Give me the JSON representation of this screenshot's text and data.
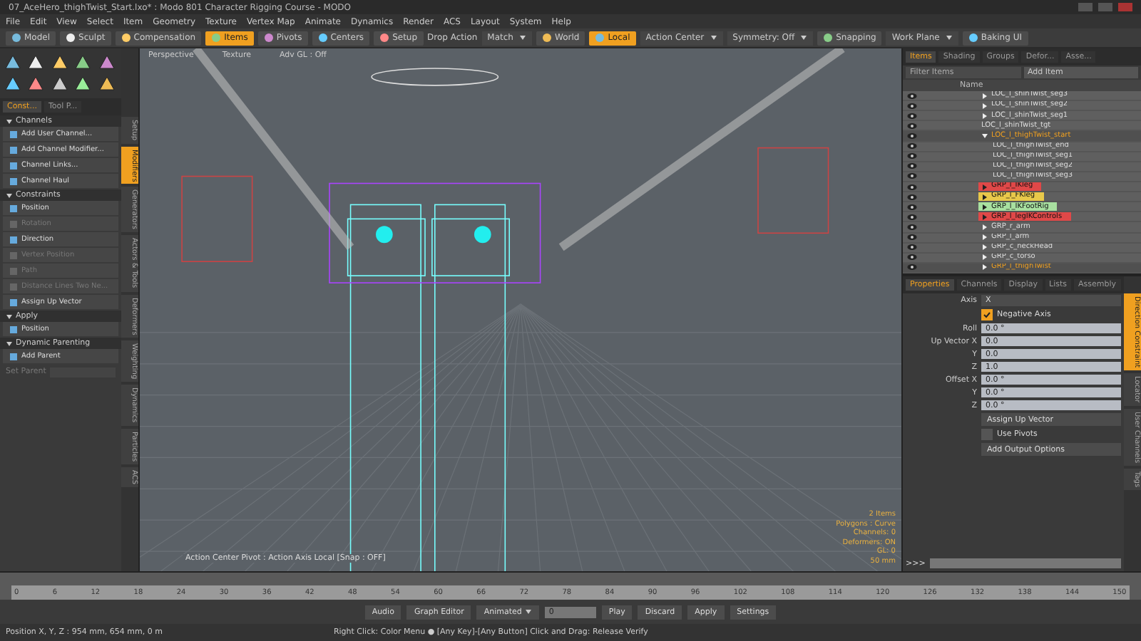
{
  "window": {
    "title": "07_AceHero_thighTwist_Start.lxo* : Modo 801 Character Rigging Course - MODO"
  },
  "menu": [
    "File",
    "Edit",
    "View",
    "Select",
    "Item",
    "Geometry",
    "Texture",
    "Vertex Map",
    "Animate",
    "Dynamics",
    "Render",
    "ACS",
    "Layout",
    "System",
    "Help"
  ],
  "toolbar": [
    {
      "kind": "button",
      "label": "Model",
      "selected": false
    },
    {
      "kind": "button",
      "label": "Sculpt",
      "selected": false
    },
    {
      "kind": "button",
      "label": "Compensation",
      "selected": false
    },
    {
      "kind": "button",
      "label": "Items",
      "selected": true
    },
    {
      "kind": "button",
      "label": "Pivots",
      "selected": false
    },
    {
      "kind": "button",
      "label": "Centers",
      "selected": false
    },
    {
      "kind": "button",
      "label": "Setup",
      "selected": false
    },
    {
      "kind": "text",
      "label": "Drop Action"
    },
    {
      "kind": "dropdown",
      "label": "Match"
    },
    {
      "kind": "button",
      "label": "World",
      "selected": false
    },
    {
      "kind": "button",
      "label": "Local",
      "selected": true
    },
    {
      "kind": "dropdown",
      "label": "Action Center"
    },
    {
      "kind": "dropdown",
      "label": "Symmetry: Off"
    },
    {
      "kind": "button",
      "label": "Snapping",
      "selected": false
    },
    {
      "kind": "dropdown",
      "label": "Work Plane"
    },
    {
      "kind": "button",
      "label": "Baking UI",
      "selected": false
    }
  ],
  "left_panel": {
    "tabs": [
      {
        "label": "Const...",
        "selected": true
      },
      {
        "label": "Tool P...",
        "selected": false
      }
    ],
    "sections": [
      {
        "title": "Channels",
        "items": [
          {
            "label": "Add User Channel...",
            "disabled": false
          },
          {
            "label": "Add Channel Modifier...",
            "disabled": false
          },
          {
            "label": "Channel Links...",
            "disabled": false
          },
          {
            "label": "Channel Haul",
            "disabled": false
          }
        ]
      },
      {
        "title": "Constraints",
        "items": [
          {
            "label": "Position",
            "disabled": false
          },
          {
            "label": "Rotation",
            "disabled": true
          },
          {
            "label": "Direction",
            "disabled": false
          },
          {
            "label": "Vertex Position",
            "disabled": true
          },
          {
            "label": "Path",
            "disabled": true
          },
          {
            "label": "Distance Lines Two Ne...",
            "disabled": true
          },
          {
            "label": "Assign Up Vector",
            "disabled": false
          }
        ]
      },
      {
        "title": "Apply",
        "items": [
          {
            "label": "Position",
            "disabled": false
          }
        ]
      },
      {
        "title": "Dynamic Parenting",
        "items": [
          {
            "label": "Add Parent",
            "disabled": false
          }
        ]
      }
    ],
    "set_parent": {
      "label": "Set Parent"
    },
    "side_tabs": [
      {
        "label": "Setup",
        "selected": false
      },
      {
        "label": "Modifiers",
        "selected": true
      },
      {
        "label": "Generators",
        "selected": false
      },
      {
        "label": "Actors & Tools",
        "selected": false
      },
      {
        "label": "Deformers",
        "selected": false
      },
      {
        "label": "Weighting",
        "selected": false
      },
      {
        "label": "Dynamics",
        "selected": false
      },
      {
        "label": "Particles",
        "selected": false
      },
      {
        "label": "ACS",
        "selected": false
      }
    ]
  },
  "viewport": {
    "tabs": [
      "Perspective",
      "Texture",
      "Adv GL : Off"
    ],
    "footer": "Action Center Pivot : Action Axis Local [Snap : OFF]",
    "info": [
      "2 Items",
      "Polygons : Curve",
      "Channels: 0",
      "Deformers: ON",
      "GL: 0",
      "50 mm"
    ]
  },
  "items_panel": {
    "tabs": [
      {
        "label": "Items",
        "selected": true
      },
      {
        "label": "Shading",
        "selected": false
      },
      {
        "label": "Groups",
        "selected": false
      },
      {
        "label": "Defor...",
        "selected": false
      },
      {
        "label": "Asse...",
        "selected": false
      }
    ],
    "filter": "Filter Items",
    "add_item": "Add Item",
    "column": "Name",
    "tree": [
      {
        "name": "LOC_l_shinTwist_seg3",
        "selected": false,
        "expanded": false
      },
      {
        "name": "LOC_l_shinTwist_seg2",
        "selected": false,
        "expanded": false
      },
      {
        "name": "LOC_l_shinTwist_seg1",
        "selected": false,
        "expanded": false
      },
      {
        "name": "LOC_l_shinTwist_tgt",
        "selected": false
      },
      {
        "name": "LOC_l_thighTwist_start",
        "selected": true,
        "expanded": true,
        "children": [
          {
            "name": "LOC_l_thighTwist_end",
            "selected": false
          },
          {
            "name": "LOC_l_thighTwist_seg1",
            "selected": false
          },
          {
            "name": "LOC_l_thighTwist_seg2",
            "selected": false
          },
          {
            "name": "LOC_l_thighTwist_seg3",
            "selected": false
          }
        ]
      },
      {
        "name": "GRP_l_IKleg",
        "selected": false,
        "expanded": false,
        "color": "#e04848"
      },
      {
        "name": "GRP_l_FKleg",
        "selected": false,
        "expanded": false,
        "color": "#e8c84a"
      },
      {
        "name": "GRP_l_IKFootRig",
        "selected": false,
        "expanded": false,
        "color": "#a8e0a0"
      },
      {
        "name": "GRP_l_legIKControls",
        "selected": false,
        "expanded": false,
        "color": "#e04848"
      },
      {
        "name": "GRP_r_arm",
        "selected": false,
        "expanded": false
      },
      {
        "name": "GRP_l_arm",
        "selected": false,
        "expanded": false
      },
      {
        "name": "GRP_c_neckHead",
        "selected": false,
        "expanded": false
      },
      {
        "name": "GRP_c_torso",
        "selected": false,
        "expanded": false
      },
      {
        "name": "GRP_l_thighTwist",
        "selected": true,
        "expanded": false
      }
    ]
  },
  "properties_panel": {
    "tabs": [
      {
        "label": "Properties",
        "selected": true
      },
      {
        "label": "Channels",
        "selected": false
      },
      {
        "label": "Display",
        "selected": false
      },
      {
        "label": "Lists",
        "selected": false
      },
      {
        "label": "Assembly",
        "selected": false
      }
    ],
    "axis": {
      "label": "Axis",
      "value": "X"
    },
    "negative_axis": {
      "label": "Negative Axis",
      "checked": true
    },
    "fields": [
      {
        "label": "Roll",
        "value": "0.0 °"
      },
      {
        "label": "Up Vector X",
        "value": "0.0"
      },
      {
        "label": "Y",
        "value": "0.0"
      },
      {
        "label": "Z",
        "value": "1.0"
      },
      {
        "label": "Offset X",
        "value": "0.0 °"
      },
      {
        "label": "Y",
        "value": "0.0 °"
      },
      {
        "label": "Z",
        "value": "0.0 °"
      }
    ],
    "assign_button": "Assign Up Vector",
    "use_pivots": {
      "label": "Use Pivots",
      "checked": false
    },
    "output_button": "Add Output Options",
    "side_tabs": [
      {
        "label": "Direction Constraint",
        "selected": true
      },
      {
        "label": "Locator",
        "selected": false
      },
      {
        "label": "User Channels",
        "selected": false
      },
      {
        "label": "Tags",
        "selected": false
      }
    ],
    "command_prompt": ">>>"
  },
  "timeline": {
    "ticks": [
      "0",
      "6",
      "12",
      "18",
      "24",
      "30",
      "36",
      "42",
      "48",
      "54",
      "60",
      "66",
      "72",
      "78",
      "84",
      "90",
      "96",
      "102",
      "108",
      "114",
      "120",
      "126",
      "132",
      "138",
      "144",
      "150"
    ]
  },
  "transport": {
    "audio": "Audio",
    "graph_editor": "Graph Editor",
    "mode": "Animated",
    "frame": "0",
    "play": "Play",
    "discard": "Discard",
    "apply": "Apply",
    "settings": "Settings"
  },
  "status_bar": {
    "position": "Position X, Y, Z :  954 mm, 654 mm, 0 m",
    "hint": "Right Click: Color Menu ● [Any Key]-[Any Button] Click and Drag: Release Verify"
  }
}
